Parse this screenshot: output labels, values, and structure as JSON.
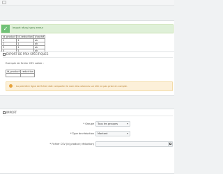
{
  "top": {
    "home_icon": "home-icon"
  },
  "alert": {
    "icon": "check-icon",
    "text": "Import réussi sans erreur",
    "color": "#dff0d8"
  },
  "results_table": {
    "headers": [
      "id_product",
      "id_reduction",
      "#caché"
    ],
    "rows": [
      [
        "1",
        "1",
        "ok"
      ],
      [
        "2",
        "1",
        "ok"
      ],
      [
        "3",
        "1",
        "ok"
      ],
      [
        "4",
        "1",
        "ok"
      ]
    ]
  },
  "export_section": {
    "title": "EXPORT DE PRIX SPÉCIFIQUES",
    "icon": "export-icon",
    "example_label": "Exemple de fichier CSV valide :",
    "example_headers": [
      "id_product",
      "reduction"
    ],
    "example_row": [
      "",
      ""
    ],
    "warning": "La première ligne de fichier doit comporter le nom des colonnes sur elle ne pas prise en compte."
  },
  "import_section": {
    "title": "IMPORT",
    "icon": "import-icon",
    "group_label": "* Groupe",
    "group_value": "Tous les groupes",
    "type_label": "* Type de réduction",
    "type_value": "Montant",
    "file_label": "* Fichier CSV (id_product; réduction)",
    "file_button_icon": "folder-icon"
  }
}
